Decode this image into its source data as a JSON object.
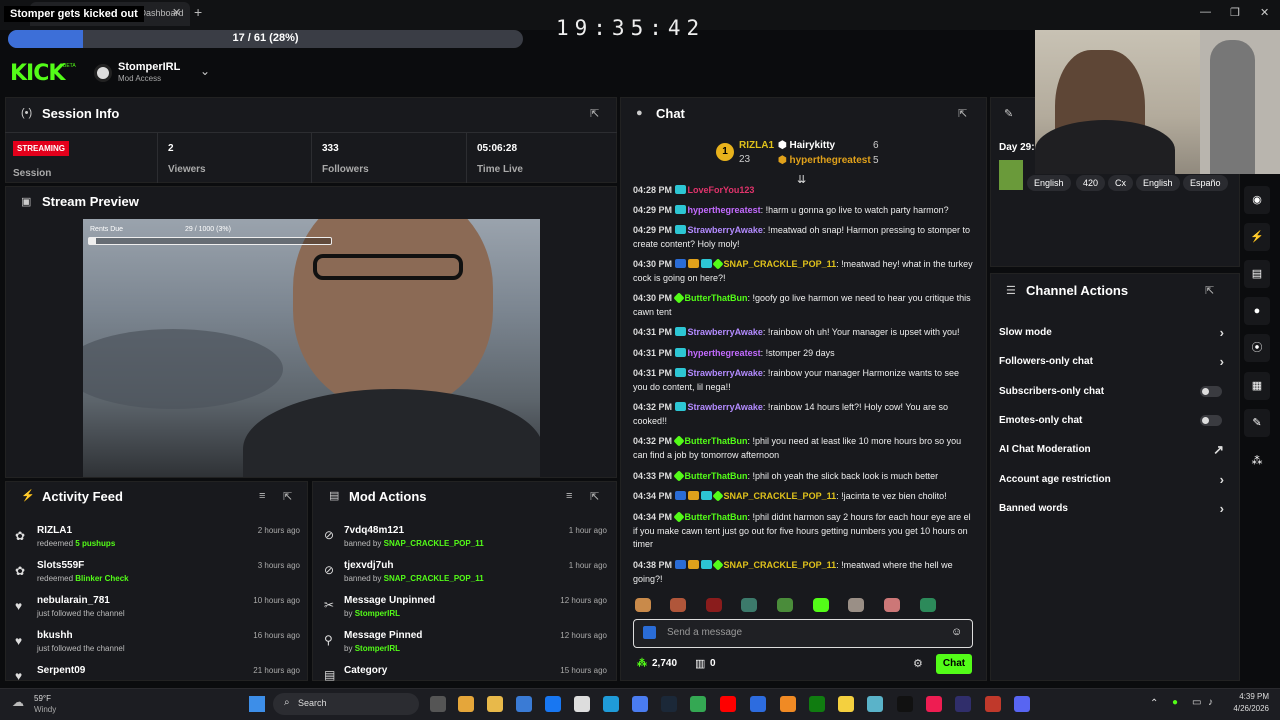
{
  "window": {
    "overlay_title": "Stomper gets kicked out",
    "tab_title": "Kick Dashboard",
    "clock": "19:35:42"
  },
  "progress": {
    "text": "17 / 61 (28%)",
    "fraction": 0.28
  },
  "header": {
    "logo": "KICK",
    "logo_badge": "BETA",
    "user": "StomperIRL",
    "role": "Mod Access"
  },
  "session": {
    "title": "Session Info",
    "badge": "STREAMING",
    "session_label": "Session",
    "viewers": "2",
    "viewers_label": "Viewers",
    "followers": "333",
    "followers_label": "Followers",
    "time_live": "05:06:28",
    "time_label": "Time Live"
  },
  "preview": {
    "title": "Stream Preview",
    "goal_label": "Rents Due",
    "goal_count": "29 / 1000 (3%)",
    "goal_fraction": 0.03
  },
  "activity": {
    "title": "Activity Feed",
    "items": [
      {
        "name": "RIZLA1",
        "action": "redeemed",
        "highlight": "5 pushups",
        "time": "2 hours ago",
        "icon": "gift-icon"
      },
      {
        "name": "Slots559F",
        "action": "redeemed",
        "highlight": "Blinker Check",
        "time": "3 hours ago",
        "icon": "gift-icon"
      },
      {
        "name": "nebularain_781",
        "action": "just followed the channel",
        "highlight": "",
        "time": "10 hours ago",
        "icon": "heart-icon"
      },
      {
        "name": "bkushh",
        "action": "just followed the channel",
        "highlight": "",
        "time": "16 hours ago",
        "icon": "heart-icon"
      },
      {
        "name": "Serpent09",
        "action": "",
        "highlight": "",
        "time": "21 hours ago",
        "icon": "heart-icon"
      }
    ]
  },
  "mod": {
    "title": "Mod Actions",
    "items": [
      {
        "name": "7vdq48m121",
        "action": "banned by",
        "by": "SNAP_CRACKLE_POP_11",
        "time": "1 hour ago",
        "icon": "ban-icon"
      },
      {
        "name": "tjexvdj7uh",
        "action": "banned by",
        "by": "SNAP_CRACKLE_POP_11",
        "time": "1 hour ago",
        "icon": "ban-icon"
      },
      {
        "name": "Message Unpinned",
        "action": "by",
        "by": "StomperIRL",
        "time": "12 hours ago",
        "icon": "unpin-icon"
      },
      {
        "name": "Message Pinned",
        "action": "by",
        "by": "StomperIRL",
        "time": "12 hours ago",
        "icon": "pin-icon"
      },
      {
        "name": "Category",
        "action": "",
        "by": "",
        "time": "15 hours ago",
        "icon": "category-icon"
      }
    ]
  },
  "chat": {
    "title": "Chat",
    "leaders": [
      {
        "rank": "1",
        "name": "RIZLA1",
        "count": "23"
      },
      {
        "name": "Hairykitty",
        "count": "6"
      },
      {
        "name": "hyperthegreatest",
        "count": "5"
      }
    ],
    "messages": [
      {
        "time": "04:28 PM",
        "user": "LoveForYou123",
        "color": "#e0336b",
        "text": ""
      },
      {
        "time": "04:29 PM",
        "user": "hyperthegreatest",
        "color": "#c36bff",
        "text": ": !harm u gonna go live to watch party harmon?"
      },
      {
        "time": "04:29 PM",
        "user": "StrawberryAwake",
        "color": "#b38bff",
        "text": ": !meatwad oh snap! Harmon pressing to stomper to create content? Holy moly!"
      },
      {
        "time": "04:30 PM",
        "user": "SNAP_CRACKLE_POP_11",
        "color": "#e0c21b",
        "text": ": !meatwad hey! what in the turkey cock is going on here?!"
      },
      {
        "time": "04:30 PM",
        "user": "ButterThatBun",
        "color": "#53fc18",
        "text": ": !goofy go live harmon we need to hear you critique this cawn tent"
      },
      {
        "time": "04:31 PM",
        "user": "StrawberryAwake",
        "color": "#b38bff",
        "text": ": !rainbow oh uh! Your manager is upset with you!"
      },
      {
        "time": "04:31 PM",
        "user": "hyperthegreatest",
        "color": "#c36bff",
        "text": ": !stomper 29 days"
      },
      {
        "time": "04:31 PM",
        "user": "StrawberryAwake",
        "color": "#b38bff",
        "text": ": !rainbow your manager Harmonize wants to see you do content, lil nega!!"
      },
      {
        "time": "04:32 PM",
        "user": "StrawberryAwake",
        "color": "#b38bff",
        "text": ": !rainbow 14 hours left?! Holy cow! You are so cooked!!"
      },
      {
        "time": "04:32 PM",
        "user": "ButterThatBun",
        "color": "#53fc18",
        "text": ": !phil you need at least like 10 more hours bro so you can find a job by tomorrow afternoon"
      },
      {
        "time": "04:33 PM",
        "user": "ButterThatBun",
        "color": "#53fc18",
        "text": ": !phil oh yeah the slick back look is much better"
      },
      {
        "time": "04:34 PM",
        "user": "SNAP_CRACKLE_POP_11",
        "color": "#e0c21b",
        "text": ": !jacinta te vez bien cholito!"
      },
      {
        "time": "04:34 PM",
        "user": "ButterThatBun",
        "color": "#53fc18",
        "text": ": !phil didnt harmon say 2 hours for each hour eye are el if you make cawn tent just go out for five hours getting numbers you get 10 hours on timer"
      },
      {
        "time": "04:38 PM",
        "user": "SNAP_CRACKLE_POP_11",
        "color": "#e0c21b",
        "text": ": !meatwad where the hell we going?!"
      }
    ],
    "placeholder": "Send a message",
    "points": "2,740",
    "gifts": "0",
    "send": "Chat"
  },
  "right": {
    "day": "Day 29:",
    "tags": [
      "English",
      "420",
      "Cx",
      "English",
      "Españo"
    ]
  },
  "channel": {
    "title": "Channel Actions",
    "items": [
      {
        "label": "Slow mode",
        "control": "chevron"
      },
      {
        "label": "Followers-only chat",
        "control": "chevron"
      },
      {
        "label": "Subscribers-only chat",
        "control": "toggle"
      },
      {
        "label": "Emotes-only chat",
        "control": "toggle"
      },
      {
        "label": "AI Chat Moderation",
        "control": "link"
      },
      {
        "label": "Account age restriction",
        "control": "chevron"
      },
      {
        "label": "Banned words",
        "control": "chevron"
      }
    ]
  },
  "taskbar": {
    "temp": "59°F",
    "weather": "Windy",
    "search": "Search",
    "time": "4:39 PM",
    "date": "4/26/2026"
  }
}
